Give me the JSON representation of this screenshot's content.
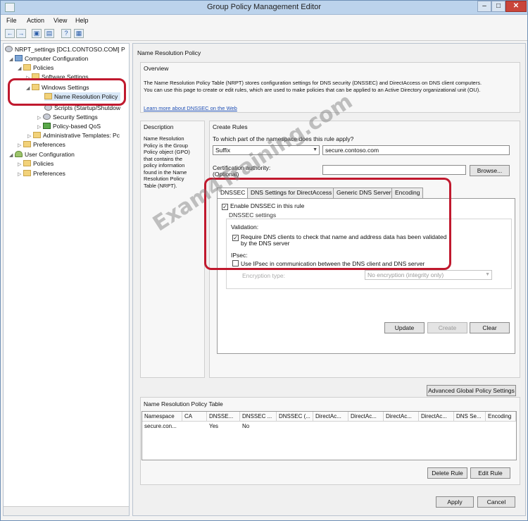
{
  "window": {
    "title": "Group Policy Management Editor",
    "min": "–",
    "max": "□",
    "close": "✕"
  },
  "menu": [
    "File",
    "Action",
    "View",
    "Help"
  ],
  "toolbar": [
    "←",
    "→",
    "▣",
    "▤",
    "?",
    "▦"
  ],
  "tree": {
    "root": "NRPT_settings [DC1.CONTOSO.COM] P",
    "computer_configuration": "Computer Configuration",
    "policies": "Policies",
    "software_settings": "Software Settings",
    "windows_settings": "Windows Settings",
    "name_resolution_policy": "Name Resolution Policy",
    "scripts": "Scripts (Startup/Shutdow",
    "security_settings": "Security Settings",
    "policy_based_qos": "Policy-based QoS",
    "admin_templates": "Administrative Templates: Pc",
    "preferences": "Preferences",
    "user_configuration": "User Configuration",
    "user_policies": "Policies",
    "user_preferences": "Preferences"
  },
  "panel": {
    "title": "Name Resolution Policy",
    "overview_label": "Overview",
    "overview_text_1": "The Name Resolution Policy Table (NRPT) stores configuration settings for DNS security (DNSSEC) and DirectAccess on DNS client computers.",
    "overview_text_2": "You can use this page to create or edit rules, which are used to make policies that can be applied to an Active Directory organizational unit (OU).",
    "learn_more": "Learn more about DNSSEC on the Web",
    "description_label": "Description",
    "description_lines": [
      "Name Resolution",
      "Policy is the Group",
      "Policy object (GPO)",
      "that contains the",
      "policy information",
      "found in the Name",
      "Resolution Policy",
      "Table (NRPT)."
    ],
    "create_rules_label": "Create Rules",
    "namespace_question": "To which part of the namespace does this rule apply?",
    "namespace_type": "Suffix",
    "namespace_value": "secure.contoso.com",
    "cert_authority_label": "Certification authority:",
    "optional_label": "(Optional)",
    "browse_button": "Browse...",
    "tabs": [
      "DNSSEC",
      "DNS Settings for DirectAccess",
      "Generic DNS Server",
      "Encoding"
    ],
    "enable_dnssec": "Enable DNSSEC in this rule",
    "dnssec_settings": "DNSSEC settings",
    "validation_label": "Validation:",
    "validation_text_1": "Require DNS clients to check that name and address data has been validated",
    "validation_text_2": "by the DNS server",
    "ipsec_label": "IPsec:",
    "ipsec_text": "Use IPsec in communication between the DNS client and DNS server",
    "encryption_type_label": "Encryption type:",
    "encryption_value": "No encryption (integrity only)",
    "update_button": "Update",
    "create_button": "Create",
    "clear_button": "Clear",
    "advanced_button": "Advanced Global Policy Settings",
    "nrpt_label": "Name Resolution Policy Table",
    "delete_rule_button": "Delete Rule",
    "edit_rule_button": "Edit Rule",
    "apply_button": "Apply",
    "cancel_button": "Cancel"
  },
  "table": {
    "columns": [
      "Namespace",
      "CA",
      "DNSSE...",
      "DNSSEC ...",
      "DNSSEC (...",
      "DirectAc...",
      "DirectAc...",
      "DirectAc...",
      "DirectAc...",
      "DNS Se...",
      "Encoding"
    ],
    "rows": [
      [
        "secure.con...",
        "",
        "Yes",
        "No",
        "",
        "",
        "",
        "",
        "",
        "",
        ""
      ]
    ]
  },
  "watermark": "Exam4Training.com",
  "colors": {
    "highlight_border": "#c0192e",
    "link": "#1f4fb5",
    "titlebar": "#bcd3ec",
    "close": "#c9453a"
  }
}
